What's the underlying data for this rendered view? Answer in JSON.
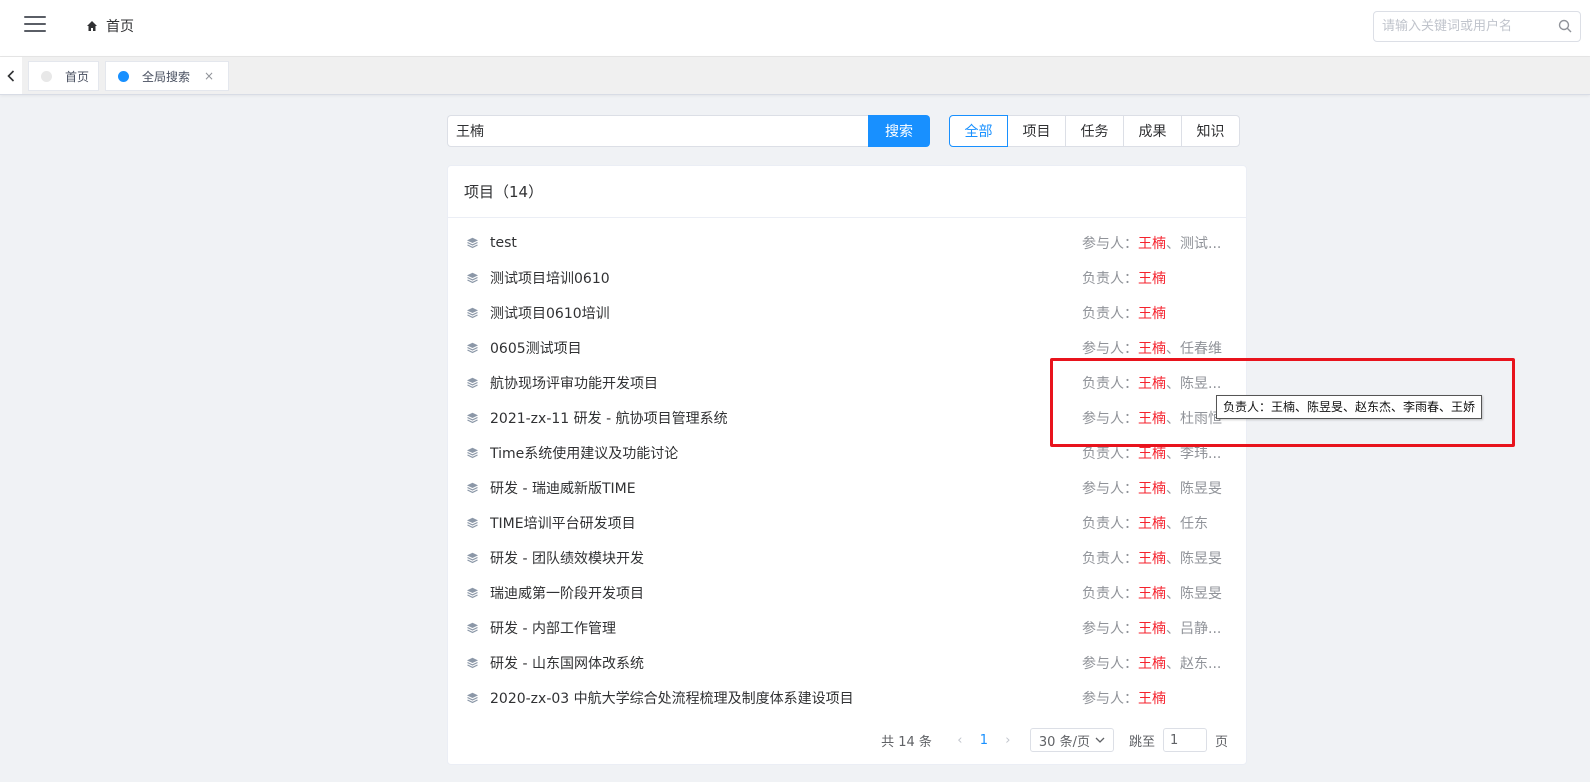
{
  "header": {
    "breadcrumb": "首页",
    "search_placeholder": "请输入关键词或用户名"
  },
  "tabs": [
    {
      "label": "首页",
      "dot_color": "#e8e8e8"
    },
    {
      "label": "全局搜索",
      "dot_color": "#1890ff",
      "close": "×"
    }
  ],
  "search": {
    "keyword": "王楠",
    "button": "搜索",
    "filters": [
      "全部",
      "项目",
      "任务",
      "成果",
      "知识"
    ],
    "active_filter": "全部"
  },
  "results": {
    "header": "项目（14）",
    "rows": [
      {
        "title": "test",
        "role": "参与人：",
        "hl": "王楠",
        "rest": "、测试..."
      },
      {
        "title": "测试项目培训0610",
        "role": "负责人：",
        "hl": "王楠",
        "rest": ""
      },
      {
        "title": "测试项目0610培训",
        "role": "负责人：",
        "hl": "王楠",
        "rest": ""
      },
      {
        "title": "0605测试项目",
        "role": "参与人：",
        "hl": "王楠",
        "rest": "、任春维"
      },
      {
        "title": "航协现场评审功能开发项目",
        "role": "负责人：",
        "hl": "王楠",
        "rest": "、陈昱..."
      },
      {
        "title": "2021-zx-11 研发 - 航协项目管理系统",
        "role": "参与人：",
        "hl": "王楠",
        "rest": "、杜雨恒"
      },
      {
        "title": "Time系统使用建议及功能讨论",
        "role": "负责人：",
        "hl": "王楠",
        "rest": "、李玮..."
      },
      {
        "title": "研发 - 瑞迪威新版TIME",
        "role": "参与人：",
        "hl": "王楠",
        "rest": "、陈昱旻"
      },
      {
        "title": "TIME培训平台研发项目",
        "role": "负责人：",
        "hl": "王楠",
        "rest": "、任东"
      },
      {
        "title": "研发 - 团队绩效模块开发",
        "role": "负责人：",
        "hl": "王楠",
        "rest": "、陈昱旻"
      },
      {
        "title": "瑞迪威第一阶段开发项目",
        "role": "负责人：",
        "hl": "王楠",
        "rest": "、陈昱旻"
      },
      {
        "title": "研发 - 内部工作管理",
        "role": "参与人：",
        "hl": "王楠",
        "rest": "、吕静..."
      },
      {
        "title": "研发 - 山东国网体改系统",
        "role": "参与人：",
        "hl": "王楠",
        "rest": "、赵东..."
      },
      {
        "title": "2020-zx-03 中航大学综合处流程梳理及制度体系建设项目",
        "role": "参与人：",
        "hl": "王楠",
        "rest": ""
      }
    ]
  },
  "pagination": {
    "total": "共 14 条",
    "prev": "‹",
    "page": "1",
    "next": "›",
    "page_size": "30 条/页",
    "jump_label": "跳至",
    "jump_value": "1",
    "page_suffix": "页"
  },
  "tooltip": "负责人：王楠、陈昱旻、赵东杰、李雨春、王娇",
  "colors": {
    "accent": "#1890ff",
    "highlight_name": "#f5222d",
    "annotation_box": "#e8131c"
  }
}
